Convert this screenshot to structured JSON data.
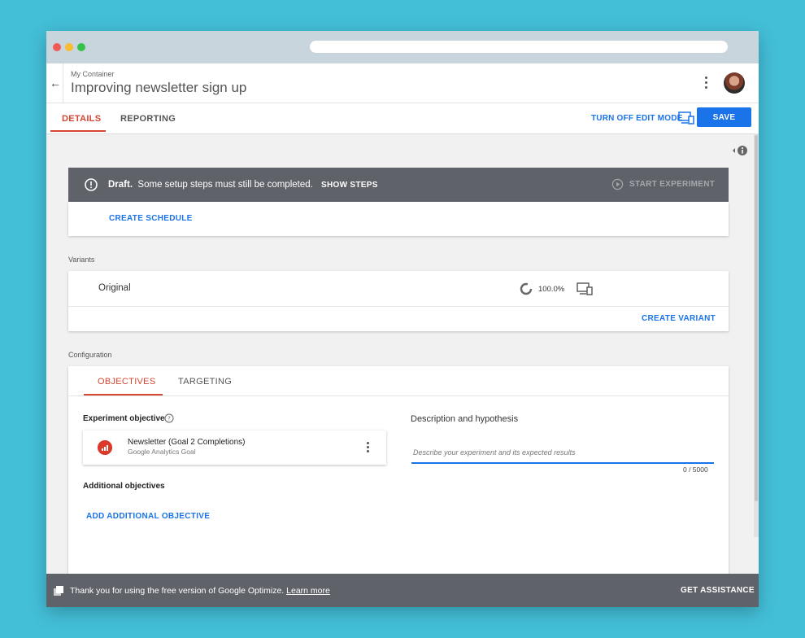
{
  "window": {
    "url": ""
  },
  "header": {
    "container_name": "My Container",
    "title": "Improving newsletter sign up",
    "back_icon": "arrow-left-icon",
    "more_icon": "more-vert-icon"
  },
  "tabs": [
    {
      "label": "DETAILS",
      "active": true
    },
    {
      "label": "REPORTING",
      "active": false
    }
  ],
  "toolbar": {
    "edit_mode_label": "TURN OFF EDIT MODE",
    "save_label": "SAVE"
  },
  "draft": {
    "status": "Draft.",
    "message": "Some setup steps must still be completed.",
    "show_steps_label": "SHOW STEPS",
    "start_label": "START EXPERIMENT"
  },
  "schedule": {
    "create_label": "CREATE SCHEDULE"
  },
  "variants": {
    "section_label": "Variants",
    "items": [
      {
        "name": "Original",
        "weight": "100.0%"
      }
    ],
    "create_label": "CREATE VARIANT"
  },
  "configuration": {
    "section_label": "Configuration",
    "tabs": [
      {
        "label": "OBJECTIVES",
        "active": true
      },
      {
        "label": "TARGETING",
        "active": false
      }
    ],
    "experiment_objective_label": "Experiment objective",
    "objective": {
      "name": "Newsletter (Goal 2 Completions)",
      "type": "Google Analytics Goal"
    },
    "additional_objectives_label": "Additional objectives",
    "add_objective_label": "ADD ADDITIONAL OBJECTIVE",
    "description_title": "Description and hypothesis",
    "description_placeholder": "Describe your experiment and its expected results",
    "char_count": "0 / 5000"
  },
  "footer": {
    "message": "Thank you for using the free version of Google Optimize.",
    "learn_more_label": "Learn more",
    "assistance_label": "GET ASSISTANCE"
  },
  "colors": {
    "accent_blue": "#1a73e8",
    "tab_red": "#d64632",
    "draft_bar": "#5f6269",
    "background": "#43bfd8"
  }
}
